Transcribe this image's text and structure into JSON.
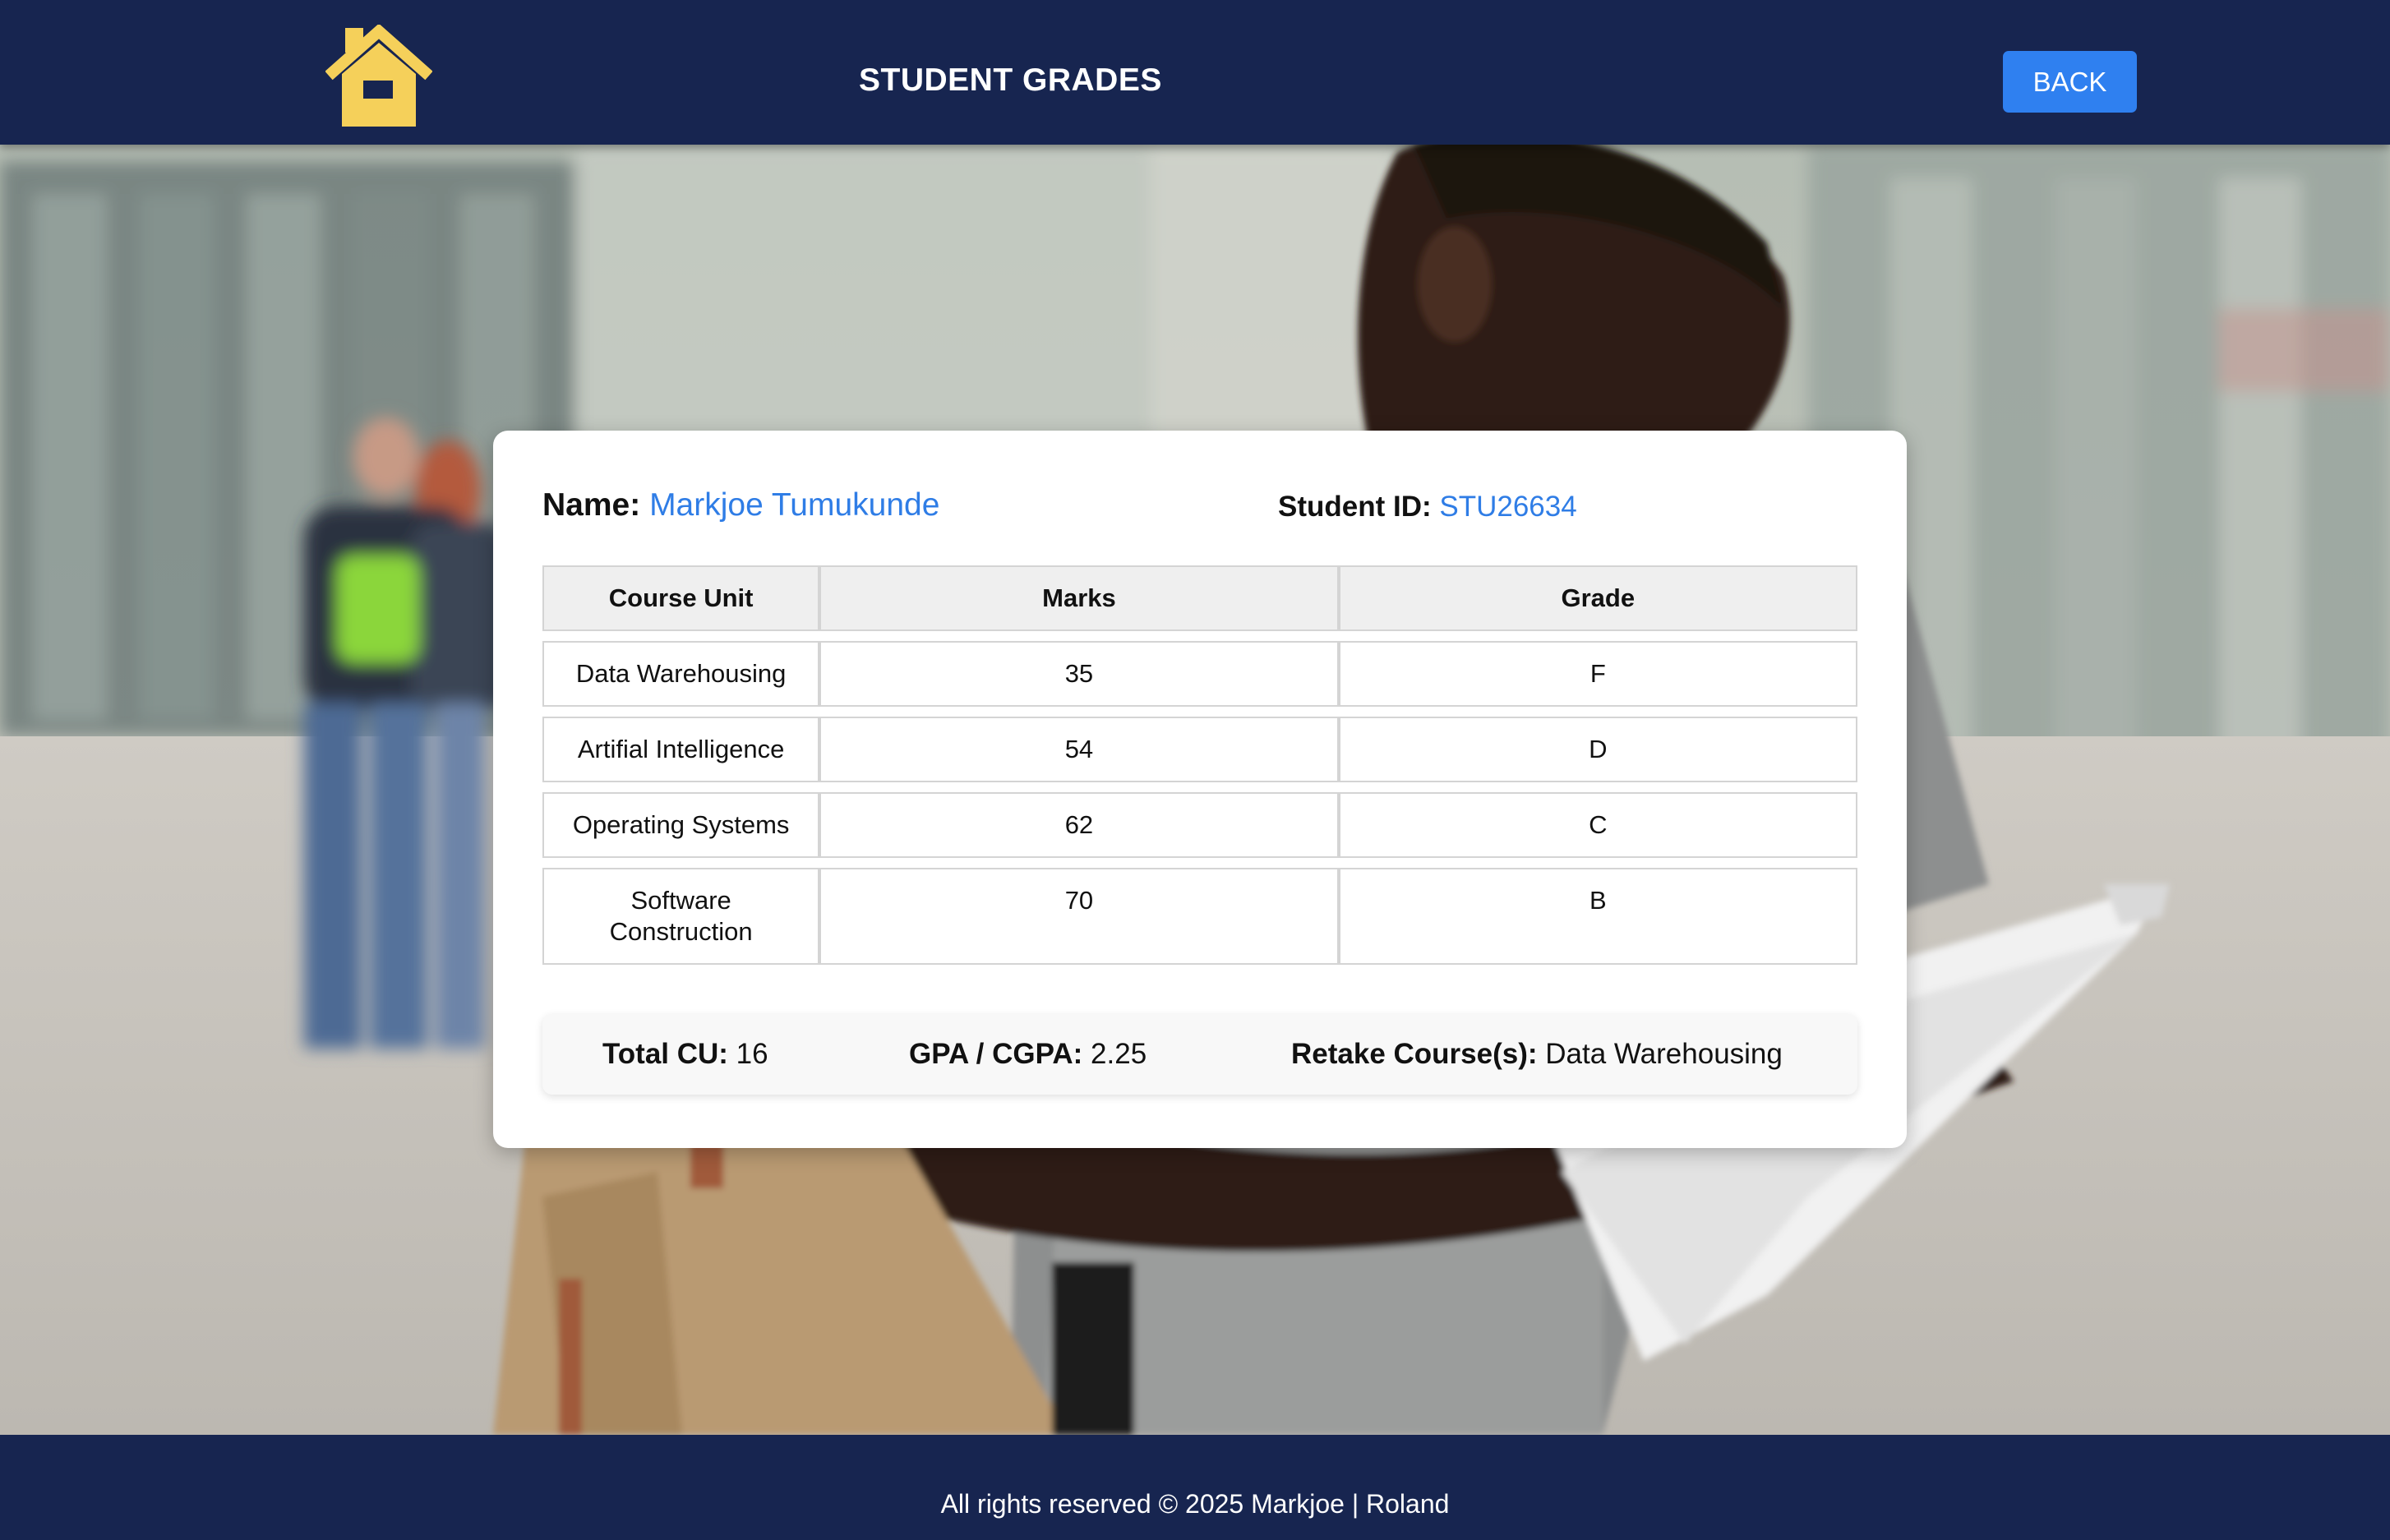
{
  "header": {
    "title": "STUDENT GRADES",
    "back_label": "BACK",
    "home_icon": "home-icon",
    "home_icon_color": "#f5d05a"
  },
  "student": {
    "name_label": "Name:",
    "name": "Markjoe Tumukunde",
    "id_label": "Student ID:",
    "id": "STU26634"
  },
  "table": {
    "headers": [
      "Course Unit",
      "Marks",
      "Grade"
    ],
    "rows": [
      {
        "course": "Data Warehousing",
        "marks": "35",
        "grade": "F"
      },
      {
        "course": "Artifial Intelligence",
        "marks": "54",
        "grade": "D"
      },
      {
        "course": "Operating Systems",
        "marks": "62",
        "grade": "C"
      },
      {
        "course": "Software Construction",
        "marks": "70",
        "grade": "B"
      }
    ]
  },
  "summary": {
    "total_cu_label": "Total CU:",
    "total_cu": "16",
    "gpa_label": "GPA / CGPA:",
    "gpa": "2.25",
    "retake_label": "Retake Course(s):",
    "retake": "Data Warehousing"
  },
  "footer": {
    "text": "All rights reserved © 2025 Markjoe | Roland"
  },
  "colors": {
    "header_bg": "#172550",
    "accent_blue": "#2f80f0",
    "link_blue": "#2f7de6"
  }
}
